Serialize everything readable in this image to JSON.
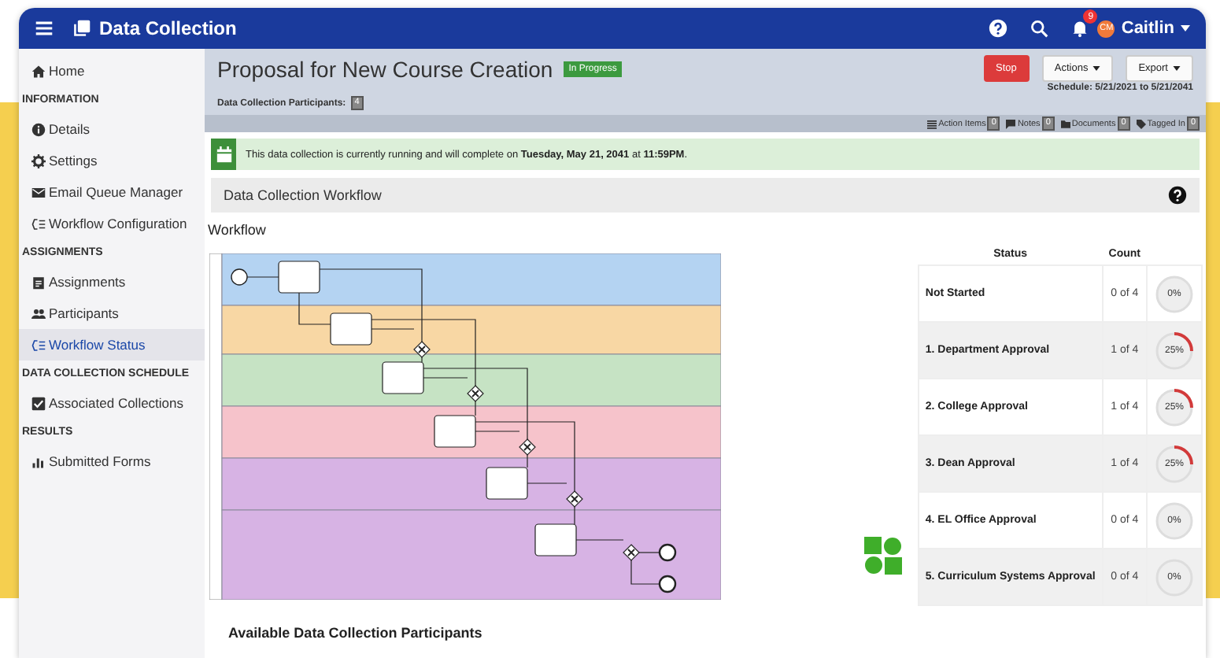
{
  "topbar": {
    "title": "Data Collection",
    "notification_count": "9",
    "user_initials": "CM",
    "user_name": "Caitlin"
  },
  "sidebar": {
    "items": [
      {
        "kind": "link",
        "label": "Home",
        "selected": false
      },
      {
        "kind": "heading",
        "label": "INFORMATION"
      },
      {
        "kind": "link",
        "label": "Details",
        "selected": false
      },
      {
        "kind": "link",
        "label": "Settings",
        "selected": false
      },
      {
        "kind": "link",
        "label": "Email Queue Manager",
        "selected": false
      },
      {
        "kind": "link",
        "label": "Workflow Configuration",
        "selected": false
      },
      {
        "kind": "heading",
        "label": "ASSIGNMENTS"
      },
      {
        "kind": "link",
        "label": "Assignments",
        "selected": false
      },
      {
        "kind": "link",
        "label": "Participants",
        "selected": false
      },
      {
        "kind": "link",
        "label": "Workflow Status",
        "selected": true
      },
      {
        "kind": "heading",
        "label": "DATA COLLECTION SCHEDULE"
      },
      {
        "kind": "link",
        "label": "Associated Collections",
        "selected": false
      },
      {
        "kind": "heading",
        "label": "RESULTS"
      },
      {
        "kind": "link",
        "label": "Submitted Forms",
        "selected": false
      }
    ]
  },
  "header": {
    "title": "Proposal for New Course Creation",
    "status_badge": "In Progress",
    "participants_label": "Data Collection Participants:",
    "participants_count": "4",
    "buttons": [
      {
        "kind": "danger",
        "label": "Stop"
      },
      {
        "kind": "dropdown",
        "label": "Actions"
      },
      {
        "kind": "dropdown",
        "label": "Export"
      }
    ],
    "schedule": "Schedule: 5/21/2021 to 5/21/2041"
  },
  "counters": [
    {
      "label": "Action Items",
      "count": "0"
    },
    {
      "label": "Notes",
      "count": "0"
    },
    {
      "label": "Documents",
      "count": "0"
    },
    {
      "label": "Tagged In",
      "count": "0"
    }
  ],
  "banner": {
    "text": "This data collection is currently running and will complete on **Tuesday, May 21, 2041** at **11:59PM**."
  },
  "section": {
    "title": "Data Collection Workflow",
    "subtitle": "Workflow"
  },
  "diagram": {
    "lanes": [
      {
        "color": "#b4d3f2"
      },
      {
        "color": "#f8d7a4"
      },
      {
        "color": "#c6e3c4"
      },
      {
        "color": "#f6c3cb"
      },
      {
        "color": "#d7b3e4"
      },
      {
        "color": "#d7b3e4"
      }
    ]
  },
  "status_table": {
    "columns": [
      "Status",
      "Count"
    ],
    "rows": [
      {
        "status": "Not Started",
        "count": "0 of 4",
        "percent": "0%"
      },
      {
        "status": "1. Department Approval",
        "count": "1 of 4",
        "percent": "25%"
      },
      {
        "status": "2. College Approval",
        "count": "1 of 4",
        "percent": "25%"
      },
      {
        "status": "3. Dean Approval",
        "count": "1 of 4",
        "percent": "25%"
      },
      {
        "status": "4. EL Office Approval",
        "count": "0 of 4",
        "percent": "0%"
      },
      {
        "status": "5. Curriculum Systems Approval",
        "count": "0 of 4",
        "percent": "0%"
      }
    ]
  },
  "footer_heading": "Available Data Collection Participants"
}
